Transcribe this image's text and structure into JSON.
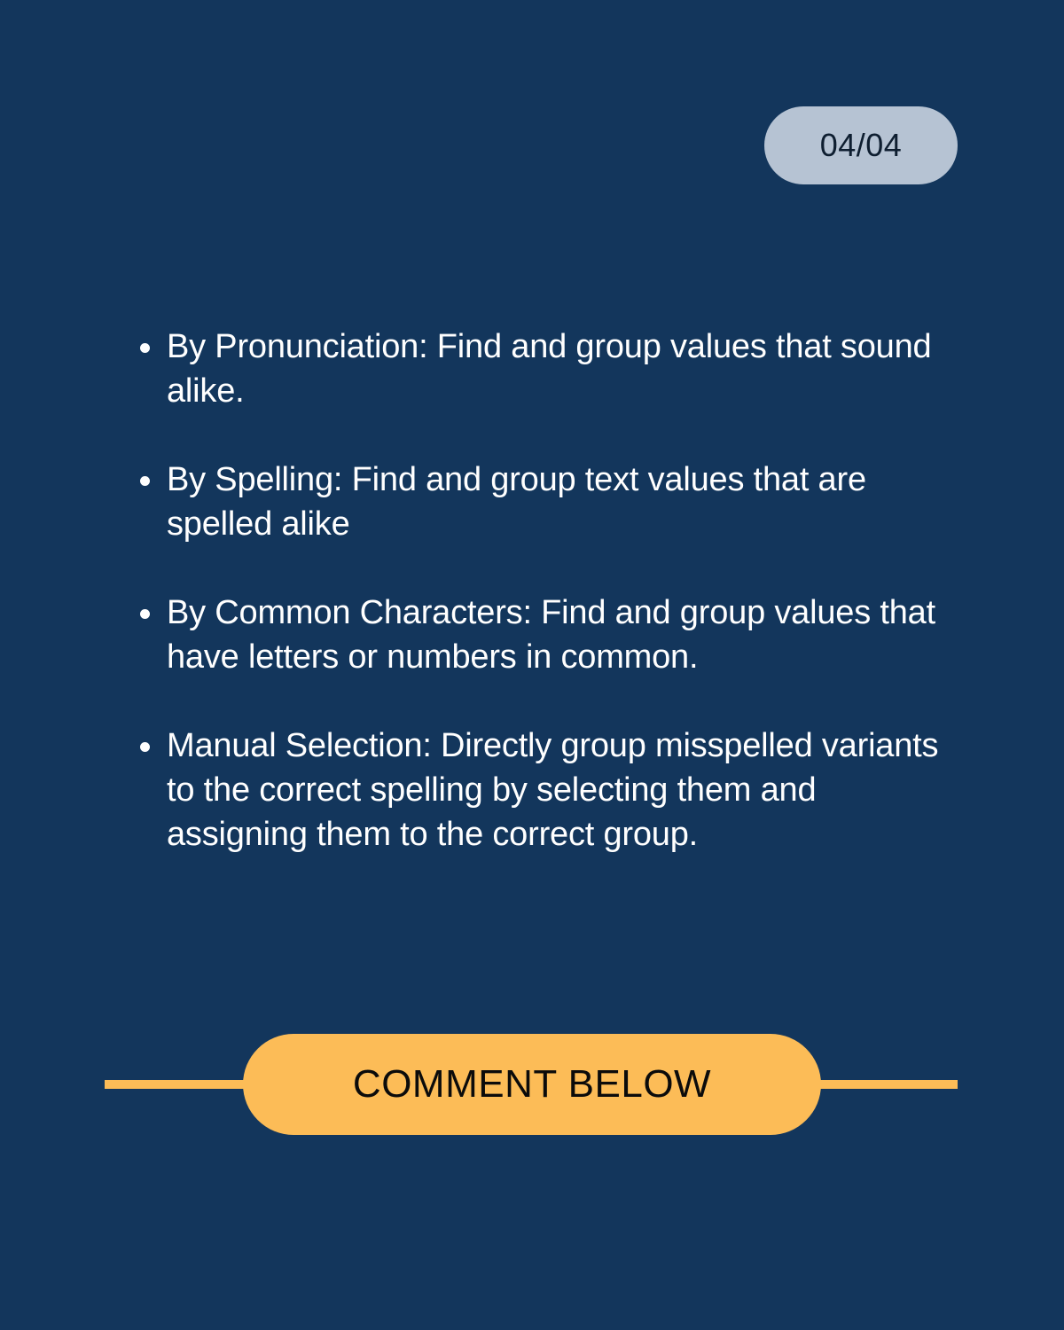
{
  "page_indicator": "04/04",
  "bullets": [
    "By Pronunciation: Find and group values that sound alike.",
    "By Spelling: Find and group text values that are spelled alike",
    "By Common Characters: Find and group values that have letters or numbers in common.",
    "Manual Selection: Directly group misspelled variants to the correct spelling by selecting them and assigning them to the correct group."
  ],
  "cta": {
    "label": "COMMENT BELOW"
  },
  "colors": {
    "background": "#13365c",
    "badge": "#b6c3d3",
    "accent": "#fcbc57",
    "text": "#ffffff"
  }
}
